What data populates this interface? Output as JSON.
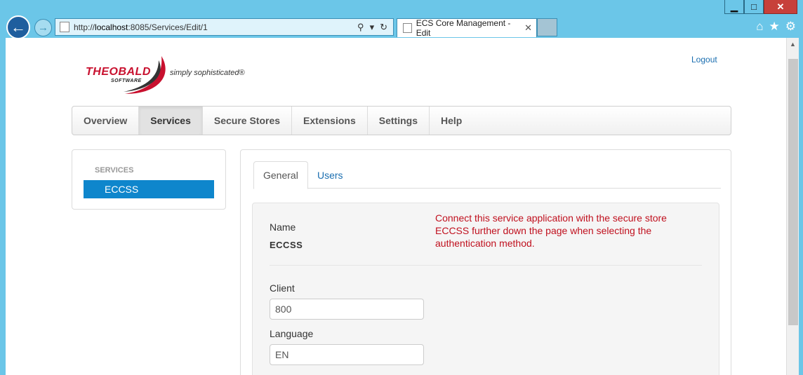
{
  "browser": {
    "url_prefix": "http://",
    "url_host": "localhost",
    "url_rest": ":8085/Services/Edit/1",
    "tab_title": "ECS Core Management - Edit"
  },
  "logo": {
    "brand": "THEOBALD",
    "sub": "SOFTWARE",
    "tagline": "simply sophisticated®"
  },
  "header": {
    "logout": "Logout"
  },
  "nav": {
    "items": [
      "Overview",
      "Services",
      "Secure Stores",
      "Extensions",
      "Settings",
      "Help"
    ],
    "active": "Services"
  },
  "sidebar": {
    "heading": "SERVICES",
    "items": [
      "ECCSS"
    ]
  },
  "tabs": {
    "general": "General",
    "users": "Users"
  },
  "form": {
    "name_label": "Name",
    "name_value": "ECCSS",
    "note": "Connect this service application with the secure store ECCSS further down the page when selecting the authentication method.",
    "client_label": "Client",
    "client_value": "800",
    "language_label": "Language",
    "language_value": "EN"
  },
  "colors": {
    "accent": "#0e86cc",
    "link": "#1a6eb0",
    "note_red": "#c0101e",
    "brand_red": "#c8102e"
  }
}
